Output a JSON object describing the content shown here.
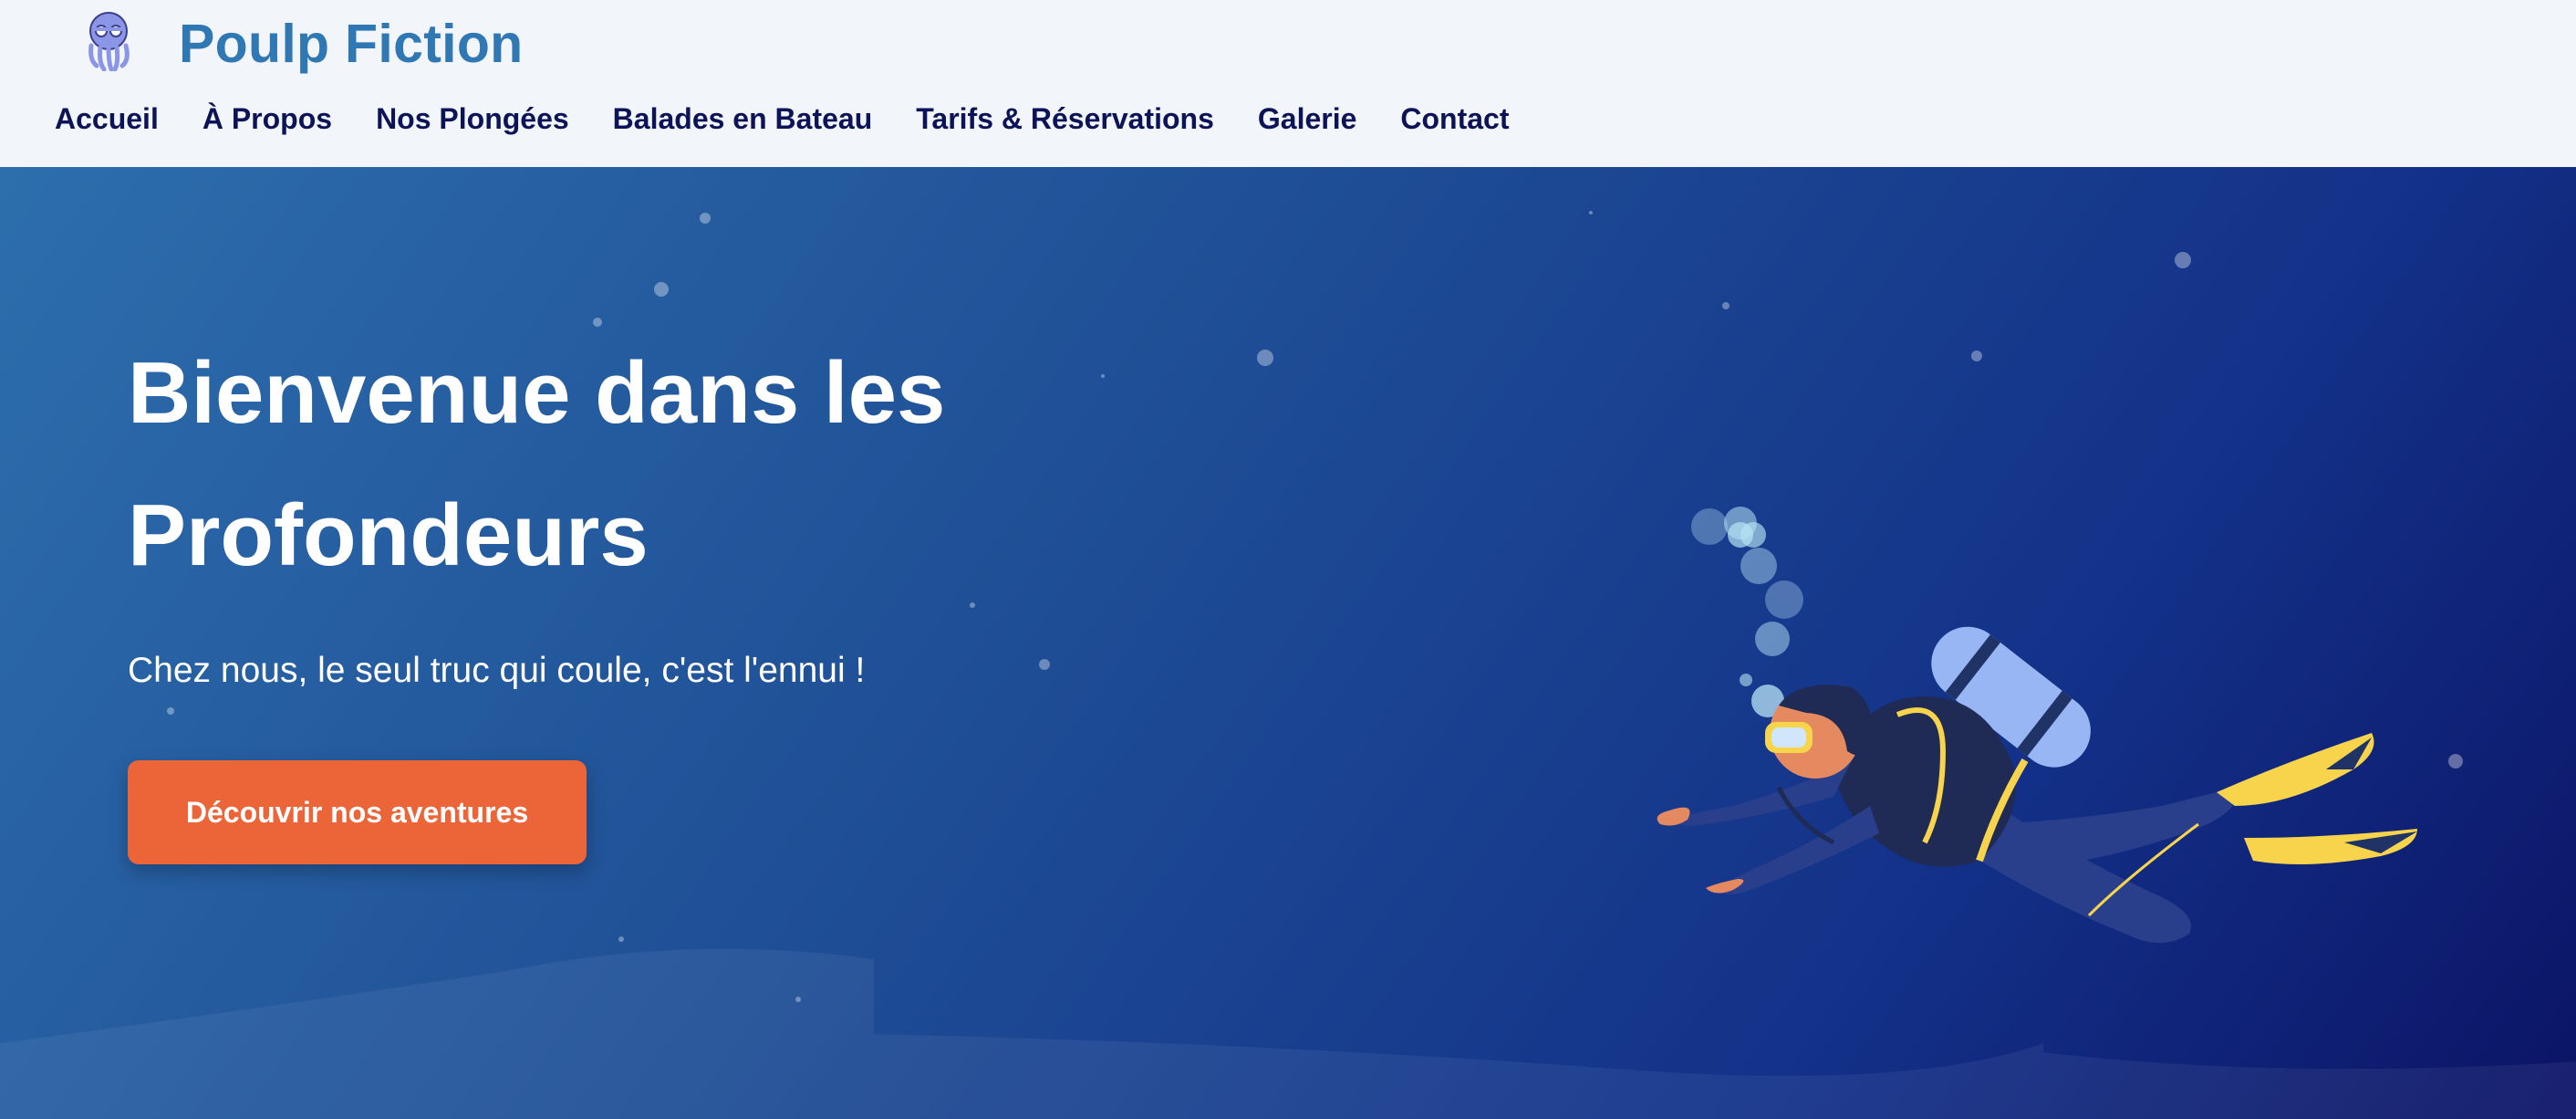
{
  "header": {
    "brand": "Poulp Fiction",
    "logo_icon": "octopus-icon",
    "nav": [
      {
        "label": "Accueil"
      },
      {
        "label": "À Propos"
      },
      {
        "label": "Nos Plongées"
      },
      {
        "label": "Balades en Bateau"
      },
      {
        "label": "Tarifs & Réservations"
      },
      {
        "label": "Galerie"
      },
      {
        "label": "Contact"
      }
    ]
  },
  "hero": {
    "title_line1": "Bienvenue dans les",
    "title_line2": "Profondeurs",
    "subtitle": "Chez nous, le seul truc qui coule, c'est l'ennui !",
    "cta_label": "Découvrir nos aventures",
    "illustration_icon": "scuba-diver-icon"
  },
  "colors": {
    "brand": "#2f78b4",
    "nav_text": "#0c1457",
    "cta": "#ec6538",
    "hero_start": "#2d6ead",
    "hero_end": "#0b1465",
    "fins": "#f7d44c"
  }
}
